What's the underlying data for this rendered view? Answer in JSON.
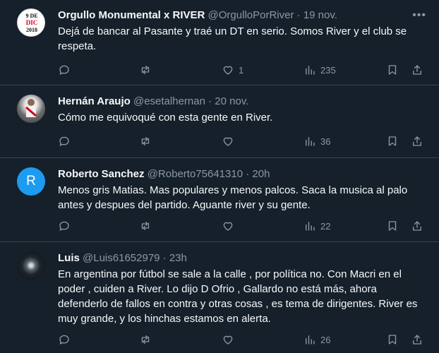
{
  "tweets": [
    {
      "name": "Orgullo Monumental x RIVER",
      "handle": "@OrgulloPorRiver",
      "time": "19 nov.",
      "text": "Dejá de bancar al Pasante y traé un DT en serio. Somos River y el club se respeta.",
      "avatar_lines": [
        "9 DE",
        "DIC",
        "2018"
      ],
      "likes": "1",
      "views": "235"
    },
    {
      "name": "Hernán Araujo",
      "handle": "@esetalhernan",
      "time": "20 nov.",
      "text": "Cómo me equivoqué con esta gente en River.",
      "likes": "",
      "views": "36"
    },
    {
      "name": "Roberto Sanchez",
      "handle": "@Roberto75641310",
      "time": "20h",
      "text": "Menos gris Matias. Mas populares y menos palcos. Saca la musica al palo antes y despues del partido. Aguante river y su gente.",
      "avatar_letter": "R",
      "likes": "",
      "views": "22"
    },
    {
      "name": "Luis",
      "handle": "@Luis61652979",
      "time": "23h",
      "text": "En argentina por fútbol se sale a la calle , por política no. Con Macri en el poder , cuiden a River. Lo dijo D Ofrio , Gallardo no está más, ahora defenderlo de fallos en contra y otras cosas , es tema de dirigentes. River es muy grande, y los hinchas estamos en alerta.",
      "likes": "",
      "views": "26"
    }
  ],
  "separator": "·",
  "colors": {
    "background": "#15202b",
    "border": "#38444d",
    "secondary_text": "#8b98a5",
    "avatar_r": "#1d9bf0"
  }
}
